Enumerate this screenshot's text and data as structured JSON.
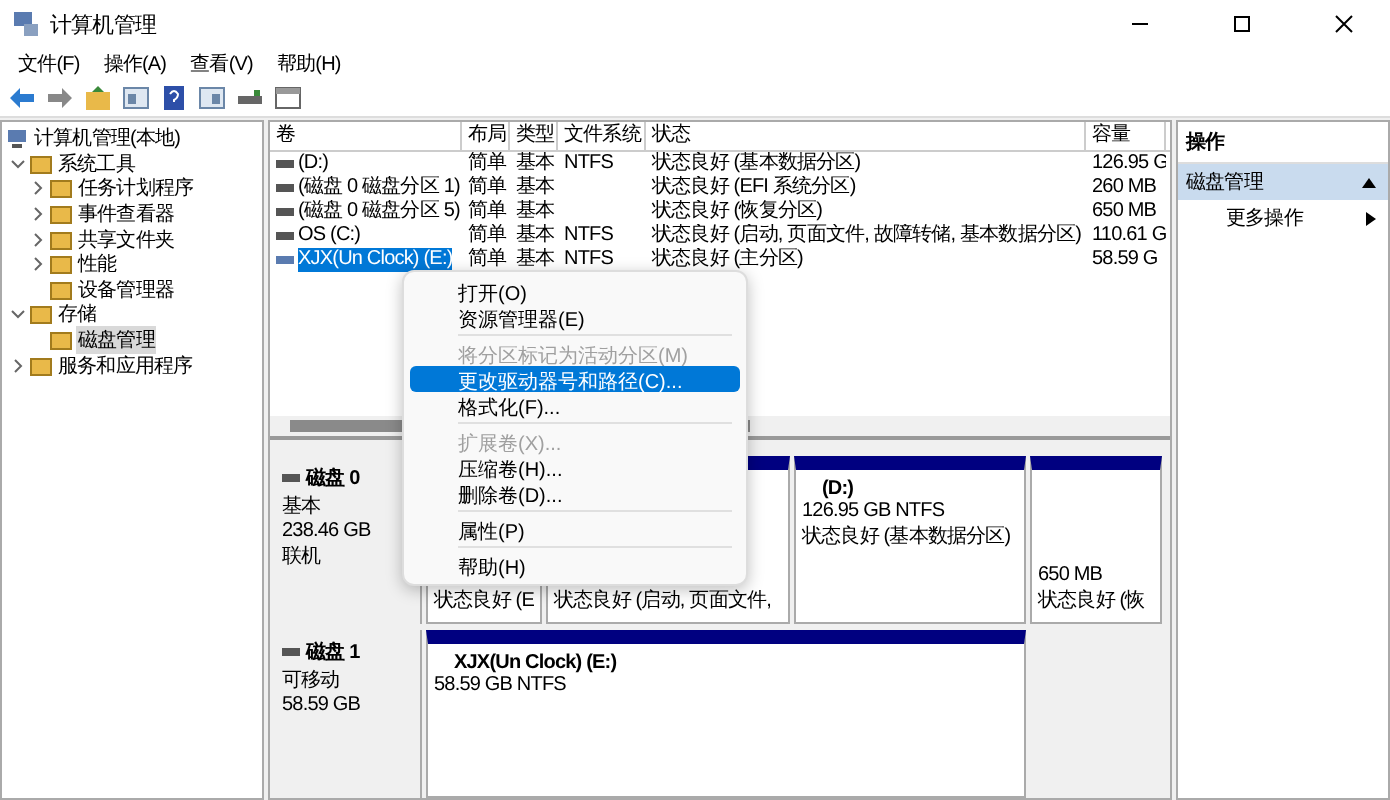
{
  "window": {
    "title": "计算机管理"
  },
  "menu_bar": [
    {
      "label": "文件(F)"
    },
    {
      "label": "操作(A)"
    },
    {
      "label": "查看(V)"
    },
    {
      "label": "帮助(H)"
    }
  ],
  "tree": [
    {
      "label": "计算机管理(本地)",
      "kind": "root",
      "selected": false,
      "children": [
        {
          "label": "系统工具",
          "kind": "node",
          "expanded": true,
          "selected": false,
          "children": [
            {
              "label": "任务计划程序",
              "kind": "node",
              "expanded": false,
              "selected": false
            },
            {
              "label": "事件查看器",
              "kind": "node",
              "expanded": false,
              "selected": false
            },
            {
              "label": "共享文件夹",
              "kind": "node",
              "expanded": false,
              "selected": false
            },
            {
              "label": "性能",
              "kind": "node",
              "expanded": false,
              "selected": false
            },
            {
              "label": "设备管理器",
              "kind": "leaf",
              "selected": false
            }
          ]
        },
        {
          "label": "存储",
          "kind": "node",
          "expanded": true,
          "selected": false,
          "children": [
            {
              "label": "磁盘管理",
              "kind": "leaf",
              "selected": true
            }
          ]
        },
        {
          "label": "服务和应用程序",
          "kind": "node",
          "expanded": false,
          "selected": false
        }
      ]
    }
  ],
  "volumes": {
    "columns": [
      "卷",
      "布局",
      "类型",
      "文件系统",
      "状态",
      "容量"
    ],
    "rows": [
      {
        "selected": false,
        "cells": [
          "(D:)",
          "简单",
          "基本",
          "NTFS",
          "状态良好 (基本数据分区)",
          "126.95 G"
        ]
      },
      {
        "selected": false,
        "cells": [
          "(磁盘 0 磁盘分区 1)",
          "简单",
          "基本",
          "",
          "状态良好 (EFI 系统分区)",
          "260 MB"
        ]
      },
      {
        "selected": false,
        "cells": [
          "(磁盘 0 磁盘分区 5)",
          "简单",
          "基本",
          "",
          "状态良好 (恢复分区)",
          "650 MB"
        ]
      },
      {
        "selected": false,
        "cells": [
          "OS (C:)",
          "简单",
          "基本",
          "NTFS",
          "状态良好 (启动, 页面文件, 故障转储, 基本数据分区)",
          "110.61 G"
        ]
      },
      {
        "selected": true,
        "cells": [
          "XJX(Un Clock) (E:)",
          "简单",
          "基本",
          "NTFS",
          "状态良好 (主分区)",
          "58.59 G"
        ]
      }
    ]
  },
  "disks": [
    {
      "name": "磁盘 0",
      "lines": [
        "基本",
        "238.46 GB",
        "联机"
      ],
      "partitions": [
        {
          "lines": [
            "状态良好 (E"
          ]
        },
        {
          "lines": [
            "状态良好 (启动, 页面文件,"
          ]
        },
        {
          "title": "(D:)",
          "lines": [
            "126.95 GB NTFS",
            "状态良好 (基本数据分区)"
          ]
        },
        {
          "lines": [
            "650 MB",
            "状态良好 (恢"
          ]
        }
      ]
    },
    {
      "name": "磁盘 1",
      "lines": [
        "可移动",
        "58.59 GB"
      ],
      "partitions": [
        {
          "title": "XJX(Un Clock)  (E:)",
          "lines": [
            "58.59 GB NTFS"
          ]
        }
      ]
    }
  ],
  "context_menu": {
    "items": [
      {
        "kind": "item",
        "label": "打开(O)",
        "disabled": false,
        "selected": false
      },
      {
        "kind": "item",
        "label": "资源管理器(E)",
        "disabled": false,
        "selected": false
      },
      {
        "kind": "separator"
      },
      {
        "kind": "item",
        "label": "将分区标记为活动分区(M)",
        "disabled": true,
        "selected": false
      },
      {
        "kind": "item",
        "label": "更改驱动器号和路径(C)...",
        "disabled": false,
        "selected": true
      },
      {
        "kind": "item",
        "label": "格式化(F)...",
        "disabled": false,
        "selected": false
      },
      {
        "kind": "separator"
      },
      {
        "kind": "item",
        "label": "扩展卷(X)...",
        "disabled": true,
        "selected": false
      },
      {
        "kind": "item",
        "label": "压缩卷(H)...",
        "disabled": false,
        "selected": false
      },
      {
        "kind": "item",
        "label": "删除卷(D)...",
        "disabled": false,
        "selected": false
      },
      {
        "kind": "separator"
      },
      {
        "kind": "item",
        "label": "属性(P)",
        "disabled": false,
        "selected": false
      },
      {
        "kind": "separator"
      },
      {
        "kind": "item",
        "label": "帮助(H)",
        "disabled": false,
        "selected": false
      }
    ]
  },
  "actions": {
    "title": "操作",
    "items": [
      {
        "kind": "group",
        "label": "磁盘管理",
        "selected": true
      },
      {
        "kind": "item",
        "label": "更多操作",
        "selected": false
      }
    ]
  }
}
